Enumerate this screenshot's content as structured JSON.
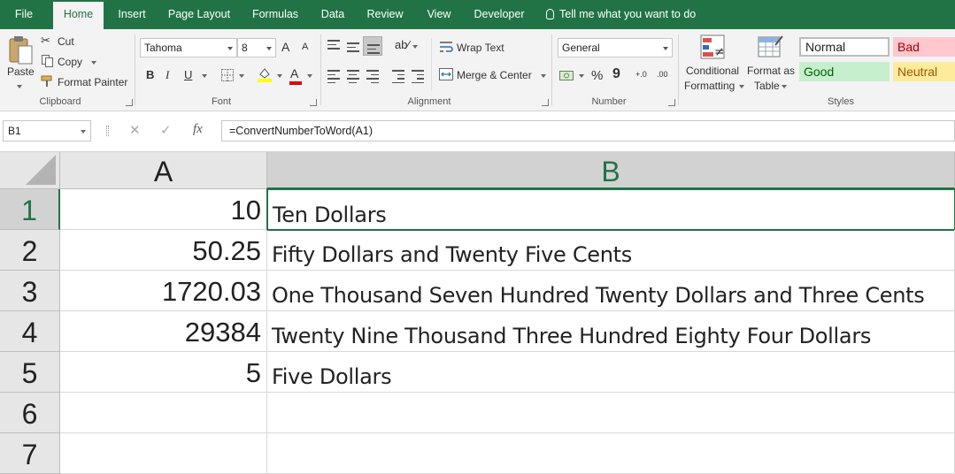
{
  "tabs": [
    {
      "label": "File"
    },
    {
      "label": "Home"
    },
    {
      "label": "Insert"
    },
    {
      "label": "Page Layout"
    },
    {
      "label": "Formulas"
    },
    {
      "label": "Data"
    },
    {
      "label": "Review"
    },
    {
      "label": "View"
    },
    {
      "label": "Developer"
    }
  ],
  "tell_me": "Tell me what you want to do",
  "clipboard": {
    "paste": "Paste",
    "cut": "Cut",
    "copy": "Copy",
    "format_painter": "Format Painter",
    "label": "Clipboard"
  },
  "font": {
    "name": "Tahoma",
    "size": "8",
    "grow": "A",
    "shrink": "A",
    "bold": "B",
    "italic": "I",
    "underline": "U",
    "color_letter": "A",
    "label": "Font"
  },
  "alignment": {
    "wrap_text": "Wrap Text",
    "merge_center": "Merge & Center",
    "label": "Alignment"
  },
  "number": {
    "format": "General",
    "percent": "%",
    "comma": "9",
    "inc_decimal": "+.0",
    "dec_decimal": ".00",
    "label": "Number"
  },
  "styles": {
    "conditional_formatting": [
      "Conditional",
      "Formatting"
    ],
    "format_as_table": [
      "Format as",
      "Table"
    ],
    "normal": "Normal",
    "bad": "Bad",
    "good": "Good",
    "neutral": "Neutral",
    "label": "Styles"
  },
  "formula_bar": {
    "name_box": "B1",
    "cancel": "✕",
    "enter": "✓",
    "fx": "fx",
    "formula": "=ConvertNumberToWord(A1)"
  },
  "grid": {
    "columns": [
      "A",
      "B"
    ],
    "rows": [
      {
        "row": "1",
        "a": "10",
        "b": "Ten Dollars"
      },
      {
        "row": "2",
        "a": "50.25",
        "b": "Fifty  Dollars and Twenty Five Cents"
      },
      {
        "row": "3",
        "a": "1720.03",
        "b": "One Thousand Seven Hundred Twenty  Dollars and Three Cents"
      },
      {
        "row": "4",
        "a": "29384",
        "b": "Twenty Nine Thousand Three Hundred Eighty Four Dollars"
      },
      {
        "row": "5",
        "a": "5",
        "b": "Five Dollars"
      },
      {
        "row": "6",
        "a": "",
        "b": ""
      },
      {
        "row": "7",
        "a": "",
        "b": ""
      }
    ]
  },
  "colors": {
    "accent": "#217346",
    "bad_bg": "#ffc7ce",
    "bad_fg": "#9c0006",
    "good_bg": "#c6efce",
    "good_fg": "#006100",
    "neutral_bg": "#ffeb9c",
    "neutral_fg": "#9c5700"
  }
}
